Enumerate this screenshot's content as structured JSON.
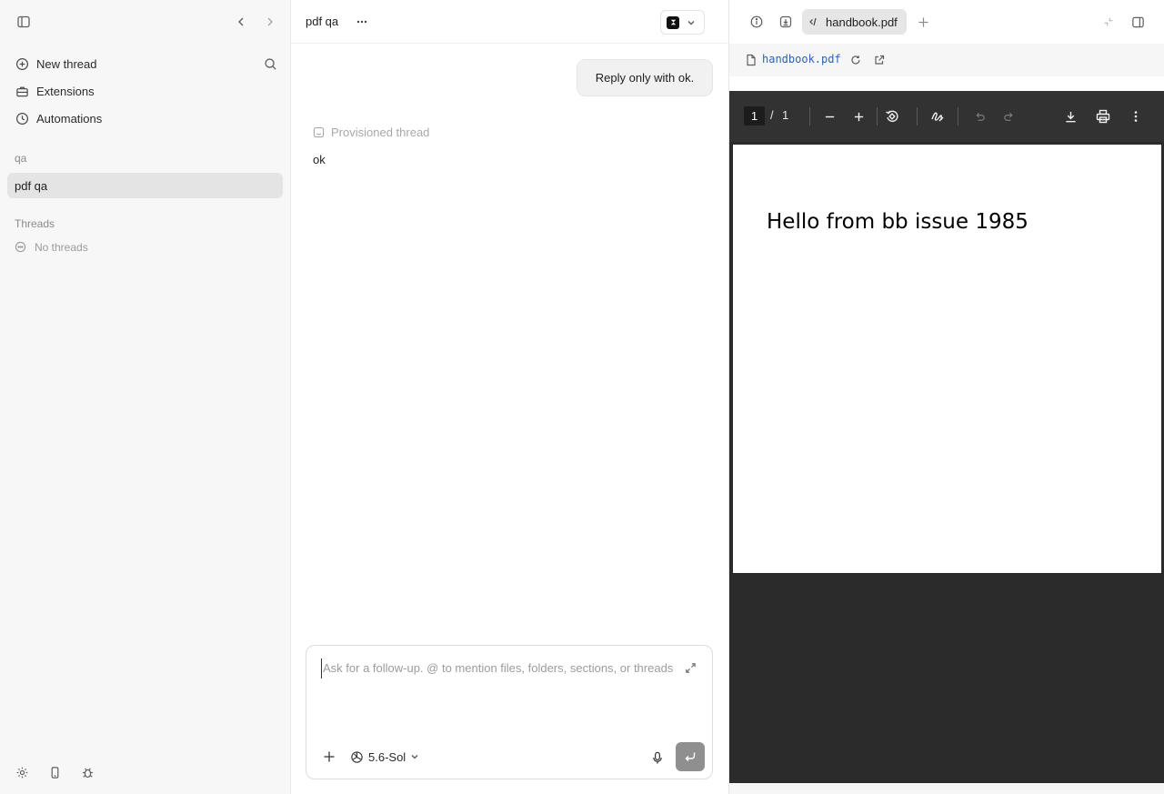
{
  "sidebar": {
    "items": [
      {
        "label": "New thread",
        "icon": "plus-circle-icon"
      },
      {
        "label": "Extensions",
        "icon": "briefcase-icon"
      },
      {
        "label": "Automations",
        "icon": "clock-icon"
      }
    ],
    "projects_label": "qa",
    "active_project": "pdf qa",
    "threads_label": "Threads",
    "threads_empty": "No threads"
  },
  "chat": {
    "title": "pdf qa",
    "user_message": "Reply only with ok.",
    "provisioned_label": "Provisioned thread",
    "assistant_message": "ok",
    "composer": {
      "placeholder": "Ask for a follow-up. @ to mention files, folders, sections, or threads",
      "model": "5.6-Sol"
    }
  },
  "browser": {
    "tab_label": "handbook.pdf",
    "url": "handbook.pdf",
    "pdf": {
      "current_page": "1",
      "separator": "/",
      "total_pages": "1",
      "content": "Hello from bb issue 1985"
    }
  },
  "colors": {
    "sidebar_bg": "#f7f7f7",
    "active_item_bg": "#e4e4e4",
    "pdf_bg": "#2b2b2b",
    "pdf_toolbar": "#323232",
    "link": "#2a63b2",
    "send_button": "#8f8f8f"
  }
}
